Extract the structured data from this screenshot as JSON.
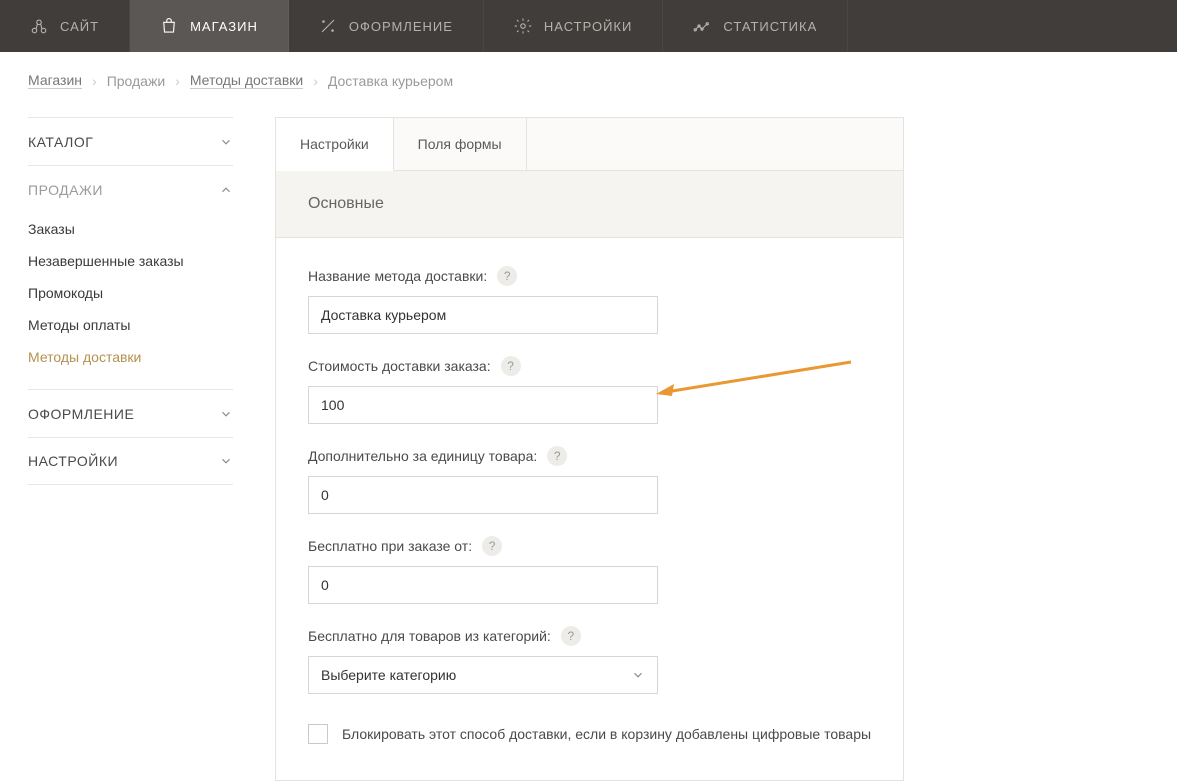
{
  "nav": {
    "items": [
      {
        "label": "САЙТ",
        "icon": "site"
      },
      {
        "label": "МАГАЗИН",
        "icon": "shop",
        "active": true
      },
      {
        "label": "ОФОРМЛЕНИЕ",
        "icon": "design"
      },
      {
        "label": "НАСТРОЙКИ",
        "icon": "settings"
      },
      {
        "label": "СТАТИСТИКА",
        "icon": "stats"
      }
    ]
  },
  "breadcrumbs": {
    "items": [
      "Магазин",
      "Продажи",
      "Методы доставки"
    ],
    "current": "Доставка курьером"
  },
  "sidebar": {
    "sections": {
      "catalog": {
        "label": "КАТАЛОГ"
      },
      "sales": {
        "label": "ПРОДАЖИ"
      },
      "design": {
        "label": "ОФОРМЛЕНИЕ"
      },
      "settings": {
        "label": "НАСТРОЙКИ"
      }
    },
    "sales_items": [
      "Заказы",
      "Незавершенные заказы",
      "Промокоды",
      "Методы оплаты",
      "Методы доставки"
    ]
  },
  "tabs": {
    "settings": "Настройки",
    "form_fields": "Поля формы"
  },
  "section_title": "Основные",
  "form": {
    "name_label": "Название метода доставки:",
    "name_value": "Доставка курьером",
    "cost_label": "Стоимость доставки заказа:",
    "cost_value": "100",
    "per_unit_label": "Дополнительно за единицу товара:",
    "per_unit_value": "0",
    "free_from_label": "Бесплатно при заказе от:",
    "free_from_value": "0",
    "free_cat_label": "Бесплатно для товаров из категорий:",
    "free_cat_placeholder": "Выберите категорию",
    "block_digital_label": "Блокировать этот способ доставки, если в корзину добавлены цифровые товары"
  }
}
